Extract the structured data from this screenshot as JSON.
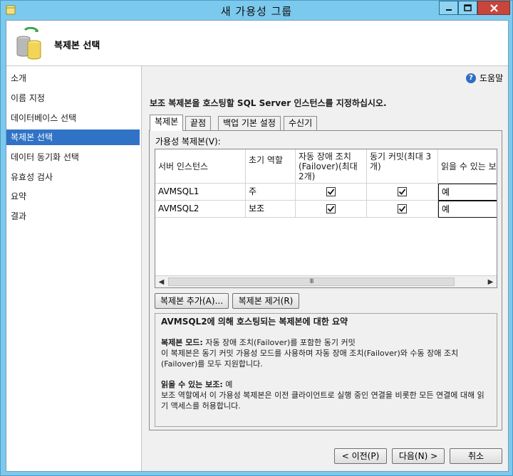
{
  "window": {
    "title": "새 가용성 그룹",
    "controls": {
      "minimize": "minimize",
      "maximize": "maximize",
      "close": "close"
    }
  },
  "header": {
    "title": "복제본 선택",
    "icon": "database-cylinders-icon"
  },
  "nav": {
    "items": [
      {
        "label": "소개",
        "active": false
      },
      {
        "label": "이름 지정",
        "active": false
      },
      {
        "label": "데이터베이스 선택",
        "active": false
      },
      {
        "label": "복제본 선택",
        "active": true
      },
      {
        "label": "데이터 동기화 선택",
        "active": false
      },
      {
        "label": "유효성 검사",
        "active": false
      },
      {
        "label": "요약",
        "active": false
      },
      {
        "label": "결과",
        "active": false
      }
    ]
  },
  "help": {
    "label": "도움말",
    "icon": "help-icon"
  },
  "instruction": "보조 복제본을 호스팅할 SQL Server 인스턴스를 지정하십시오.",
  "tabs": [
    {
      "label": "복제본",
      "active": true
    },
    {
      "label": "끝점",
      "active": false
    },
    {
      "label": "백업 기본 설정",
      "active": false
    },
    {
      "label": "수신기",
      "active": false
    }
  ],
  "grid": {
    "label": "가용성 복제본(V):",
    "columns": [
      "서버 인스턴스",
      "초기 역할",
      "자동 장애 조치(Failover)(최대 2개)",
      "동기 커밋(최대 3개)",
      "읽을 수 있는 보"
    ],
    "rows": [
      {
        "server": "AVMSQL1",
        "role": "주",
        "auto_failover": true,
        "sync_commit": true,
        "readable": "예"
      },
      {
        "server": "AVMSQL2",
        "role": "보조",
        "auto_failover": true,
        "sync_commit": true,
        "readable": "예"
      }
    ],
    "scroll_thumb": "III"
  },
  "buttons": {
    "add_replica": "복제본 추가(A)...",
    "remove_replica": "복제본 제거(R)",
    "previous": "< 이전(P)",
    "next": "다음(N) >",
    "cancel": "취소"
  },
  "summary": {
    "heading": "AVMSQL2에 의해 호스팅되는 복제본에 대한 요약",
    "mode_label": "복제본 모드:",
    "mode_value": " 자동 장애 조치(Failover)를 포함한 동기 커밋",
    "mode_desc": "이 복제본은 동기 커밋 가용성 모드를 사용하며 자동 장애 조치(Failover)와 수동 장애 조치(Failover)를 모두 지원합니다.",
    "readable_label": "읽을 수 있는 보조:",
    "readable_value": " 예",
    "readable_desc": "보조 역할에서 이 가용성 복제본은 이전 클라이언트로 실행 중인 연결을 비롯한 모든 연결에 대해 읽기 액세스를 허용합니다."
  },
  "colors": {
    "titlebar": "#7cc9ee",
    "nav_active": "#3073c6",
    "close": "#c7463c"
  }
}
